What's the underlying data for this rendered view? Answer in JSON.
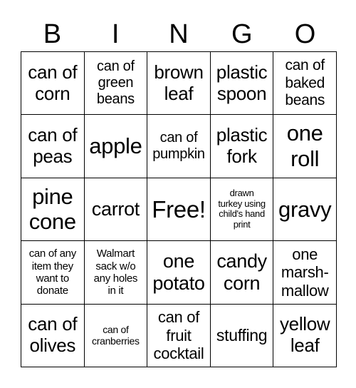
{
  "header": [
    "B",
    "I",
    "N",
    "G",
    "O"
  ],
  "cells": [
    {
      "text": "can of\ncorn",
      "size": 26
    },
    {
      "text": "can of\ngreen\nbeans",
      "size": 20
    },
    {
      "text": "brown\nleaf",
      "size": 26
    },
    {
      "text": "plastic\nspoon",
      "size": 26
    },
    {
      "text": "can of\nbaked\nbeans",
      "size": 21
    },
    {
      "text": "can of\npeas",
      "size": 26
    },
    {
      "text": "apple",
      "size": 31
    },
    {
      "text": "can of\npumpkin",
      "size": 20
    },
    {
      "text": "plastic\nfork",
      "size": 26
    },
    {
      "text": "one\nroll",
      "size": 31
    },
    {
      "text": "pine\ncone",
      "size": 31
    },
    {
      "text": "carrot",
      "size": 27
    },
    {
      "text": "Free!",
      "size": 33
    },
    {
      "text": "drawn\nturkey using\nchild's hand\nprint",
      "size": 13
    },
    {
      "text": "gravy",
      "size": 31
    },
    {
      "text": "can of any\nitem they\nwant to\ndonate",
      "size": 15
    },
    {
      "text": "Walmart\nsack w/o\nany holes\nin it",
      "size": 15
    },
    {
      "text": "one\npotato",
      "size": 27
    },
    {
      "text": "candy\ncorn",
      "size": 27
    },
    {
      "text": "one\nmarsh-\nmallow",
      "size": 22
    },
    {
      "text": "can of\nolives",
      "size": 26
    },
    {
      "text": "can of\ncranberries",
      "size": 14
    },
    {
      "text": "can of\nfruit\ncocktail",
      "size": 22
    },
    {
      "text": "stuffing",
      "size": 23
    },
    {
      "text": "yellow\nleaf",
      "size": 26
    }
  ]
}
